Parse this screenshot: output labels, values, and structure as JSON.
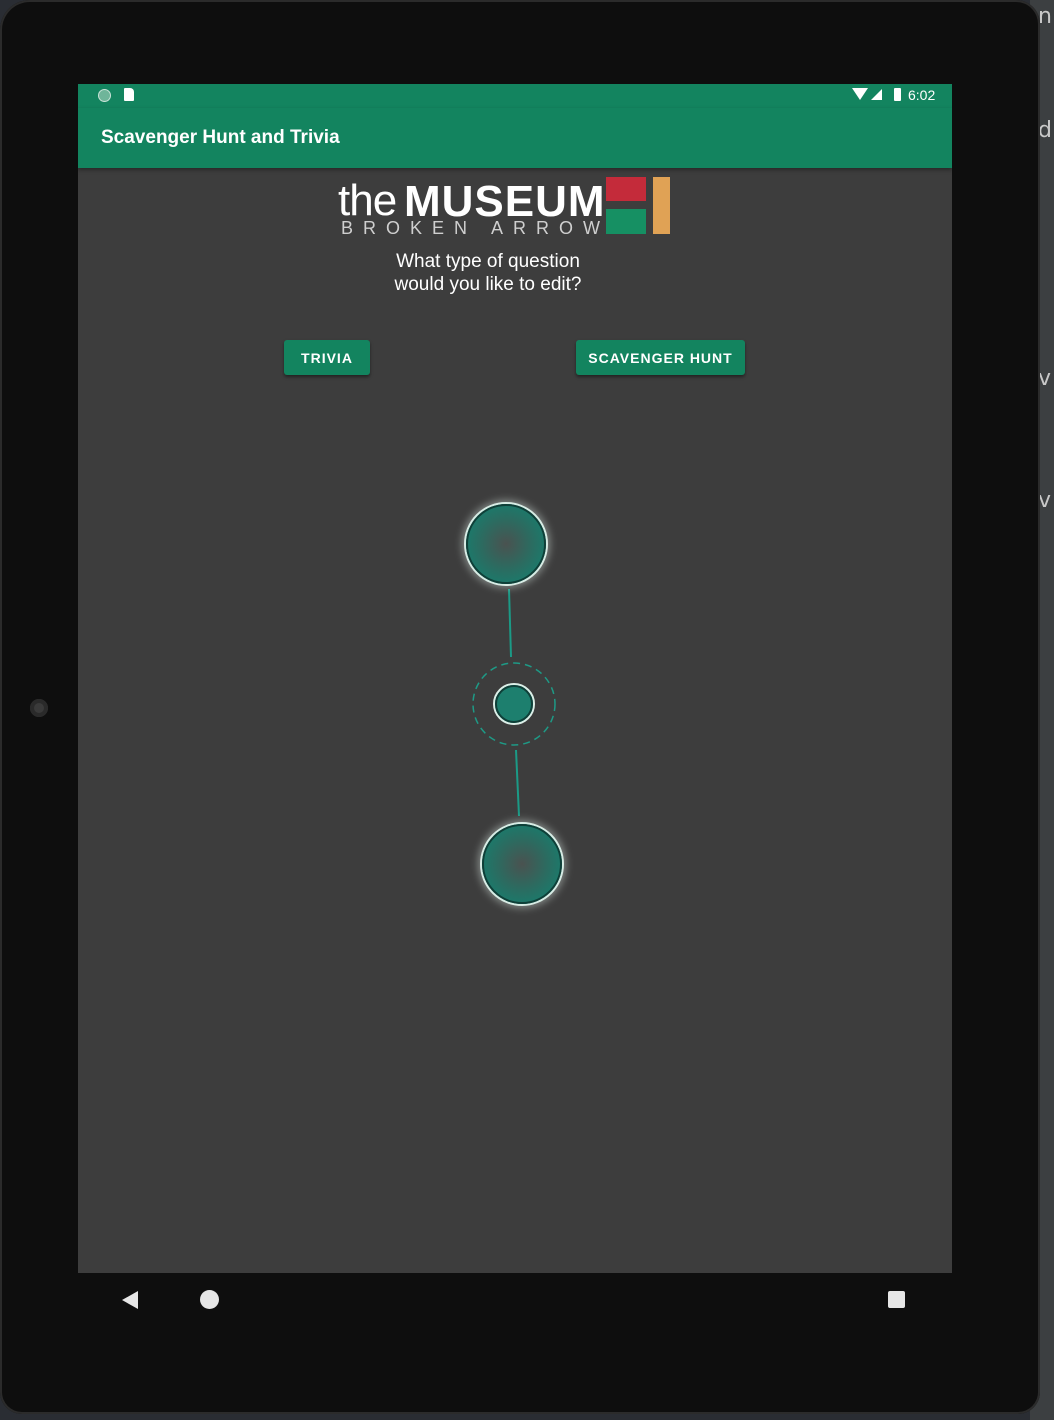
{
  "ide": {
    "edge_chars": [
      "n",
      "d",
      "v",
      "v"
    ]
  },
  "status_bar": {
    "time": "6:02",
    "left_icons": [
      "notification-dot-icon",
      "sd-card-icon"
    ],
    "right_icons": [
      "wifi-icon",
      "signal-icon",
      "battery-icon"
    ]
  },
  "app_bar": {
    "title": "Scavenger Hunt and Trivia",
    "color": "#13845f"
  },
  "logo": {
    "the": "the",
    "museum": "MUSEUM",
    "subtitle": "BROKEN ARROW"
  },
  "question": {
    "line1": "What type of question",
    "line2": "would you like to edit?"
  },
  "buttons": {
    "trivia": "TRIVIA",
    "scavenger_hunt": "SCAVENGER HUNT"
  },
  "navigation": {
    "icons": [
      "back-icon",
      "home-icon",
      "recents-icon"
    ]
  },
  "colors": {
    "accent": "#13845f",
    "background": "#3d3d3d",
    "circle_fill": "#1d7f6e",
    "circle_border": "#0f3f38"
  }
}
